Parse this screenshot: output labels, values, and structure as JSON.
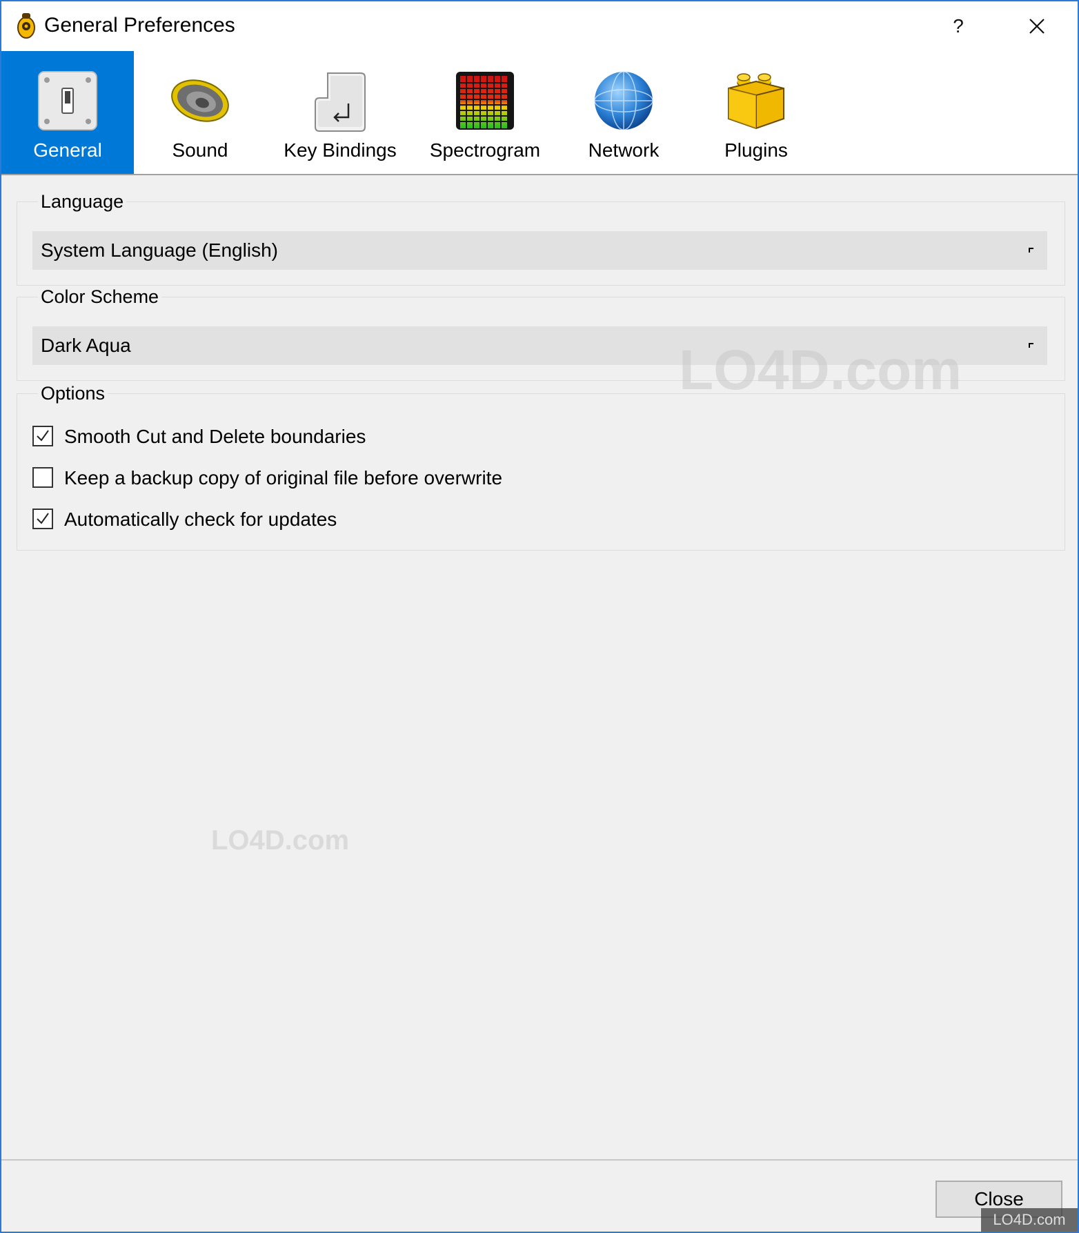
{
  "window": {
    "title": "General Preferences",
    "help_label": "?",
    "close_label": "✕"
  },
  "toolbar": {
    "items": [
      {
        "label": "General",
        "icon": "switch-icon",
        "active": true
      },
      {
        "label": "Sound",
        "icon": "speaker-icon",
        "active": false
      },
      {
        "label": "Key Bindings",
        "icon": "enter-key-icon",
        "active": false
      },
      {
        "label": "Spectrogram",
        "icon": "spectrogram-icon",
        "active": false
      },
      {
        "label": "Network",
        "icon": "globe-icon",
        "active": false
      },
      {
        "label": "Plugins",
        "icon": "lego-brick-icon",
        "active": false
      }
    ],
    "active_color": "#0078d7"
  },
  "language": {
    "group_title": "Language",
    "selected": "System Language (English)"
  },
  "color_scheme": {
    "group_title": "Color Scheme",
    "selected": "Dark Aqua"
  },
  "options": {
    "group_title": "Options",
    "items": [
      {
        "label": "Smooth Cut and Delete boundaries",
        "checked": true
      },
      {
        "label": "Keep a backup copy of original file before overwrite",
        "checked": false
      },
      {
        "label": "Automatically check for updates",
        "checked": true
      }
    ]
  },
  "watermark": {
    "text": "LO4D.com"
  },
  "footer": {
    "close_button_label": "Close"
  }
}
